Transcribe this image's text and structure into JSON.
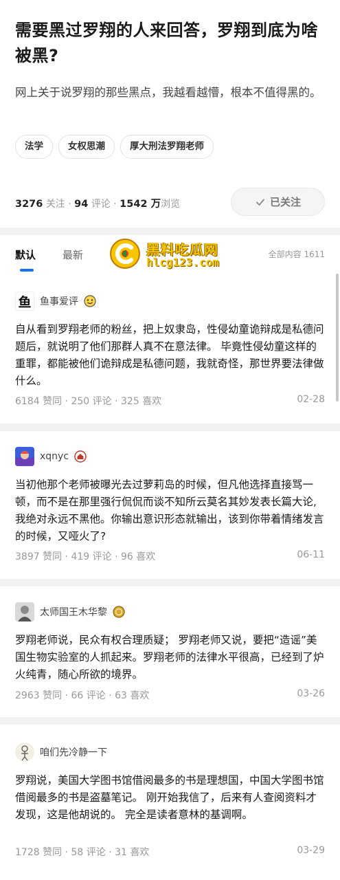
{
  "question": {
    "title": "需要黑过罗翔的人来回答，罗翔到底为啥被黑?",
    "description": "网上关于说罗翔的那些黑点，我越看越懵，根本不值得黑的。",
    "tags": [
      "法学",
      "女权思潮",
      "厚大刑法罗翔老师"
    ],
    "follow_count": "3276",
    "follow_label": "关注",
    "comment_count": "94",
    "comment_label": "评论",
    "view_count": "1542 万",
    "view_label": "浏览",
    "follow_button": "已关注",
    "sep": " · "
  },
  "tabs": {
    "default": "默认",
    "latest": "最新",
    "total": "全部内容 1611"
  },
  "watermark": {
    "line1": "黑料吃瓜网",
    "line2": "hlcg123.com"
  },
  "labels": {
    "likes": "赞同",
    "comments": "评论",
    "favorites": "喜欢",
    "dot": " · "
  },
  "answers": [
    {
      "avatar_icon": "fish-character-avatar",
      "avatar_char": "鱼",
      "author": "鱼事爱评",
      "badge_icon": "emoji-badge",
      "body": "自从看到罗翔老师的粉丝，把上奴隶岛，性侵幼童诡辩成是私德问题后，就说明了他们那群人真不在意法律。 毕竟性侵幼童这样的重罪，都能被他们诡辩成是私德问题，我就奇怪，那世界要法律做什么。",
      "likes": "6184",
      "comments": "250",
      "favorites": "325",
      "date": "02-28"
    },
    {
      "avatar_icon": "game-character-avatar",
      "avatar_char": "",
      "author": "xqnyc",
      "badge_icon": "red-house-badge",
      "body": "当初他那个老师被曝光去过萝莉岛的时候，但凡他选择直接骂一顿，而不是在那里强行侃侃而谈不知所云莫名其妙发表长篇大论,我绝对永远不黑他。你输出意识形态就输出，该到你带着情绪发言的时候，又哑火了?",
      "likes": "3897",
      "comments": "419",
      "favorites": "96",
      "date": "06-11"
    },
    {
      "avatar_icon": "portrait-avatar",
      "avatar_char": "",
      "author": "太师国王木华黎",
      "badge_icon": "gold-coin-badge",
      "body": "罗翔老师说，民众有权合理质疑； 罗翔老师又说，要把“造谣”美国生物实验室的人抓起来。罗翔老师的法律水平很高，已经到了炉火纯青，随心所欲的境界。",
      "likes": "2963",
      "comments": "66",
      "favorites": "63",
      "date": "03-26"
    },
    {
      "avatar_icon": "sketch-figure-avatar",
      "avatar_char": "",
      "author": "咱们先冷静一下",
      "badge_icon": "",
      "body": "罗翔说，美国大学图书馆借阅最多的书是理想国，中国大学图书馆借阅最多的书是盗墓笔记。 刚开始我信了，后来有人查阅资料才发现，这是他胡说的。 完全是读者意林的基调啊。",
      "likes": "1728",
      "comments": "58",
      "favorites": "31",
      "date": "03-29"
    }
  ],
  "colors": {
    "accent": "#1772f6",
    "divider": "#f2f2f2",
    "muted": "#999999",
    "watermark": "#f2c500"
  }
}
